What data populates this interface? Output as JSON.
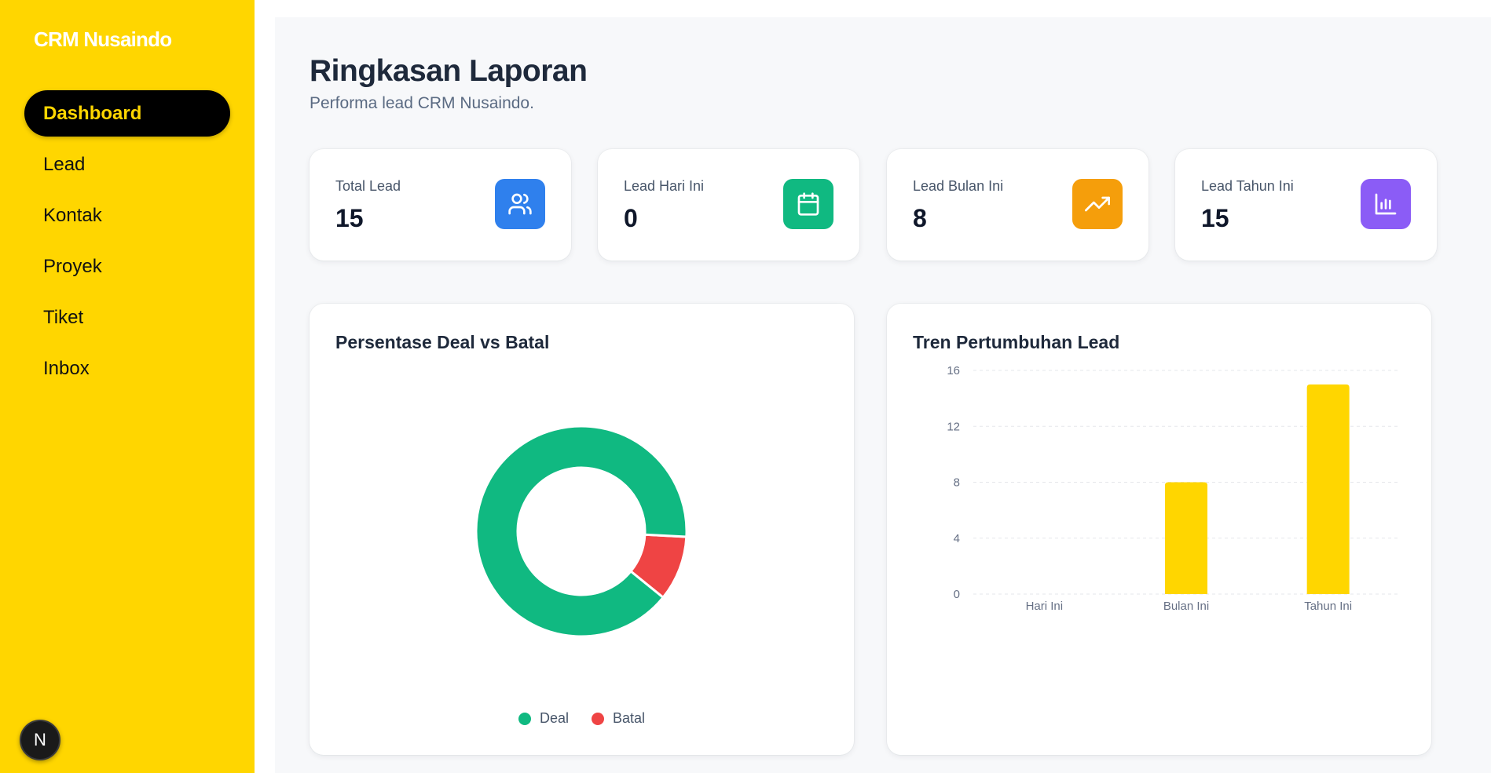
{
  "sidebar": {
    "brand": "CRM Nusaindo",
    "items": [
      {
        "label": "Dashboard",
        "active": true
      },
      {
        "label": "Lead",
        "active": false
      },
      {
        "label": "Kontak",
        "active": false
      },
      {
        "label": "Proyek",
        "active": false
      },
      {
        "label": "Tiket",
        "active": false
      },
      {
        "label": "Inbox",
        "active": false
      }
    ],
    "dev_badge": "N"
  },
  "header": {
    "title": "Ringkasan Laporan",
    "subtitle": "Performa lead CRM Nusaindo."
  },
  "stats": [
    {
      "label": "Total Lead",
      "value": "15",
      "icon": "users-icon",
      "color": "#2F80ED"
    },
    {
      "label": "Lead Hari Ini",
      "value": "0",
      "icon": "calendar-icon",
      "color": "#10B981"
    },
    {
      "label": "Lead Bulan Ini",
      "value": "8",
      "icon": "trending-up-icon",
      "color": "#F59E0B"
    },
    {
      "label": "Lead Tahun Ini",
      "value": "15",
      "icon": "bar-chart-icon",
      "color": "#8B5CF6"
    }
  ],
  "colors": {
    "sidebar_bg": "#FFD600",
    "active_nav_bg": "#000000",
    "deal": "#10B981",
    "batal": "#EF4444",
    "bar": "#FFD600"
  },
  "chart_data": [
    {
      "type": "pie",
      "title": "Persentase Deal vs Batal",
      "donut": true,
      "labels": [
        "Deal",
        "Batal"
      ],
      "values": [
        90,
        10
      ],
      "colors": [
        "#10B981",
        "#EF4444"
      ],
      "legend": "bottom"
    },
    {
      "type": "bar",
      "title": "Tren Pertumbuhan Lead",
      "categories": [
        "Hari Ini",
        "Bulan Ini",
        "Tahun Ini"
      ],
      "values": [
        0,
        8,
        15
      ],
      "ylim": [
        0,
        16
      ],
      "yticks": [
        0,
        4,
        8,
        12,
        16
      ],
      "grid": true,
      "color": "#FFD600"
    }
  ]
}
